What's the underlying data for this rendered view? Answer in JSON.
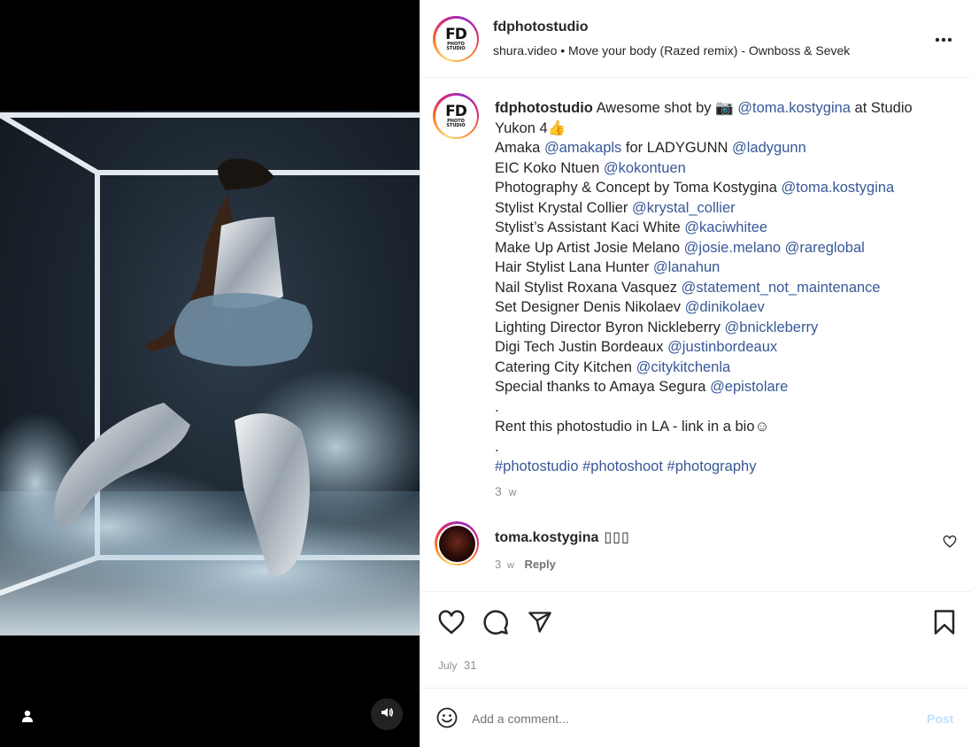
{
  "post": {
    "username": "fdphotostudio",
    "avatar_text": "FD",
    "avatar_subtext": "PHOTO STUDIO",
    "audio": "shura.video • Move your body (Razed remix) - Ownboss & Sevek"
  },
  "caption": {
    "username": "fdphotostudio",
    "lines": [
      [
        {
          "t": "Awesome shot by 📷 "
        },
        {
          "t": "@toma.kostygina",
          "m": 1
        },
        {
          "t": " at Studio"
        }
      ],
      [
        {
          "t": "Yukon 4👍"
        }
      ],
      [
        {
          "t": "Amaka "
        },
        {
          "t": "@amakapls",
          "m": 1
        },
        {
          "t": " for LADYGUNN "
        },
        {
          "t": "@ladygunn",
          "m": 1
        }
      ],
      [
        {
          "t": "EIC Koko Ntuen "
        },
        {
          "t": "@kokontuen",
          "m": 1
        }
      ],
      [
        {
          "t": "Photography & Concept by Toma Kostygina "
        },
        {
          "t": "@toma.kostygina",
          "m": 1
        }
      ],
      [
        {
          "t": "Stylist Krystal Collier "
        },
        {
          "t": "@krystal_collier",
          "m": 1
        }
      ],
      [
        {
          "t": "Stylist’s Assistant Kaci White "
        },
        {
          "t": "@kaciwhitee",
          "m": 1
        }
      ],
      [
        {
          "t": "Make Up Artist Josie Melano "
        },
        {
          "t": "@josie.melano",
          "m": 1
        },
        {
          "t": " "
        },
        {
          "t": "@rareglobal",
          "m": 1
        }
      ],
      [
        {
          "t": "Hair Stylist Lana Hunter "
        },
        {
          "t": "@lanahun",
          "m": 1
        }
      ],
      [
        {
          "t": "Nail Stylist Roxana Vasquez "
        },
        {
          "t": "@statement_not_maintenance",
          "m": 1
        }
      ],
      [
        {
          "t": "Set Designer Denis Nikolaev "
        },
        {
          "t": "@dinikolaev",
          "m": 1
        }
      ],
      [
        {
          "t": "Lighting Director Byron Nickleberry "
        },
        {
          "t": "@bnickleberry",
          "m": 1
        }
      ],
      [
        {
          "t": "Digi Tech Justin Bordeaux "
        },
        {
          "t": "@justinbordeaux",
          "m": 1
        }
      ],
      [
        {
          "t": "Catering City Kitchen "
        },
        {
          "t": "@citykitchenla",
          "m": 1
        }
      ],
      [
        {
          "t": "Special thanks to Amaya Segura "
        },
        {
          "t": "@epistolare",
          "m": 1
        }
      ],
      [
        {
          "t": "."
        }
      ],
      [
        {
          "t": "Rent this photostudio in LA - link in a bio☺"
        }
      ],
      [
        {
          "t": "."
        }
      ],
      [
        {
          "t": "#photostudio",
          "m": 1
        },
        {
          "t": " "
        },
        {
          "t": "#photoshoot",
          "m": 1
        },
        {
          "t": " "
        },
        {
          "t": "#photography",
          "m": 1
        }
      ]
    ],
    "time_num": "3",
    "time_unit": "w"
  },
  "comment": {
    "username": "toma.kostygina",
    "text": "▯▯▯",
    "time_num": "3",
    "time_unit": "w",
    "reply_label": "Reply"
  },
  "footer": {
    "date_month": "July",
    "date_day": "31",
    "comment_placeholder": "Add a comment...",
    "post_label": "Post"
  },
  "icons": {
    "more": "more-horizontal-icon",
    "like": "heart-icon",
    "comment": "comment-icon",
    "share": "paper-plane-icon",
    "save": "bookmark-icon",
    "emoji": "emoji-icon",
    "user_tag": "user-icon",
    "audio": "speaker-icon"
  },
  "colors": {
    "link": "#385898",
    "text": "#262626",
    "muted": "#8e8e8e",
    "post_disabled": "#c0dffd"
  }
}
